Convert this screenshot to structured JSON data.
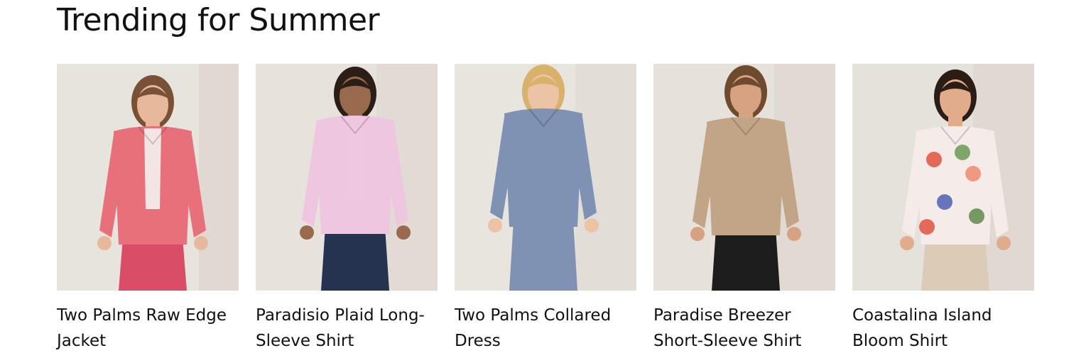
{
  "section": {
    "title": "Trending for Summer"
  },
  "products": [
    {
      "name": "Two Palms Raw Edge Jacket",
      "image_alt": "Woman in pink raw edge jacket",
      "colors": {
        "bg": "#e7e3dd",
        "wall": "#d9d2c7",
        "garment": "#e8707a",
        "bottom": "#d94e66",
        "skin": "#e8b89c",
        "hair": "#7a5136",
        "inner": "#f4f2ee"
      }
    },
    {
      "name": "Paradisio Plaid Long-Sleeve Shirt",
      "image_alt": "Man in pink plaid long-sleeve shirt",
      "colors": {
        "bg": "#e7e2dc",
        "wall": "#ddd6cd",
        "garment": "#efc6e0",
        "bottom": "#253350",
        "skin": "#9a6a4e",
        "hair": "#2b1e17",
        "inner": "#efc6e0"
      }
    },
    {
      "name": "Two Palms Collared Dress",
      "image_alt": "Woman in blue collared dress",
      "colors": {
        "bg": "#e8e4de",
        "wall": "#ddd7cf",
        "garment": "#7f92b3",
        "bottom": "#7f92b3",
        "skin": "#ecc3a5",
        "hair": "#d8b26b",
        "inner": "#7f92b3"
      }
    },
    {
      "name": "Paradise Breezer Short-Sleeve Shirt",
      "image_alt": "Man in tan short-sleeve shirt",
      "colors": {
        "bg": "#e6e1da",
        "wall": "#dcd5cc",
        "garment": "#c2a487",
        "bottom": "#1d1d1d",
        "skin": "#d6a282",
        "hair": "#6e4a2e",
        "inner": "#c2a487"
      }
    },
    {
      "name": "Coastalina Island Bloom Shirt",
      "image_alt": "Woman in floral bloom shirt",
      "colors": {
        "bg": "#e5e1db",
        "wall": "#dad3ca",
        "garment": "#f5ecea",
        "bottom": "#dcccb7",
        "skin": "#e0ac8b",
        "hair": "#2b1d16",
        "inner": "#f5ecea"
      }
    }
  ]
}
